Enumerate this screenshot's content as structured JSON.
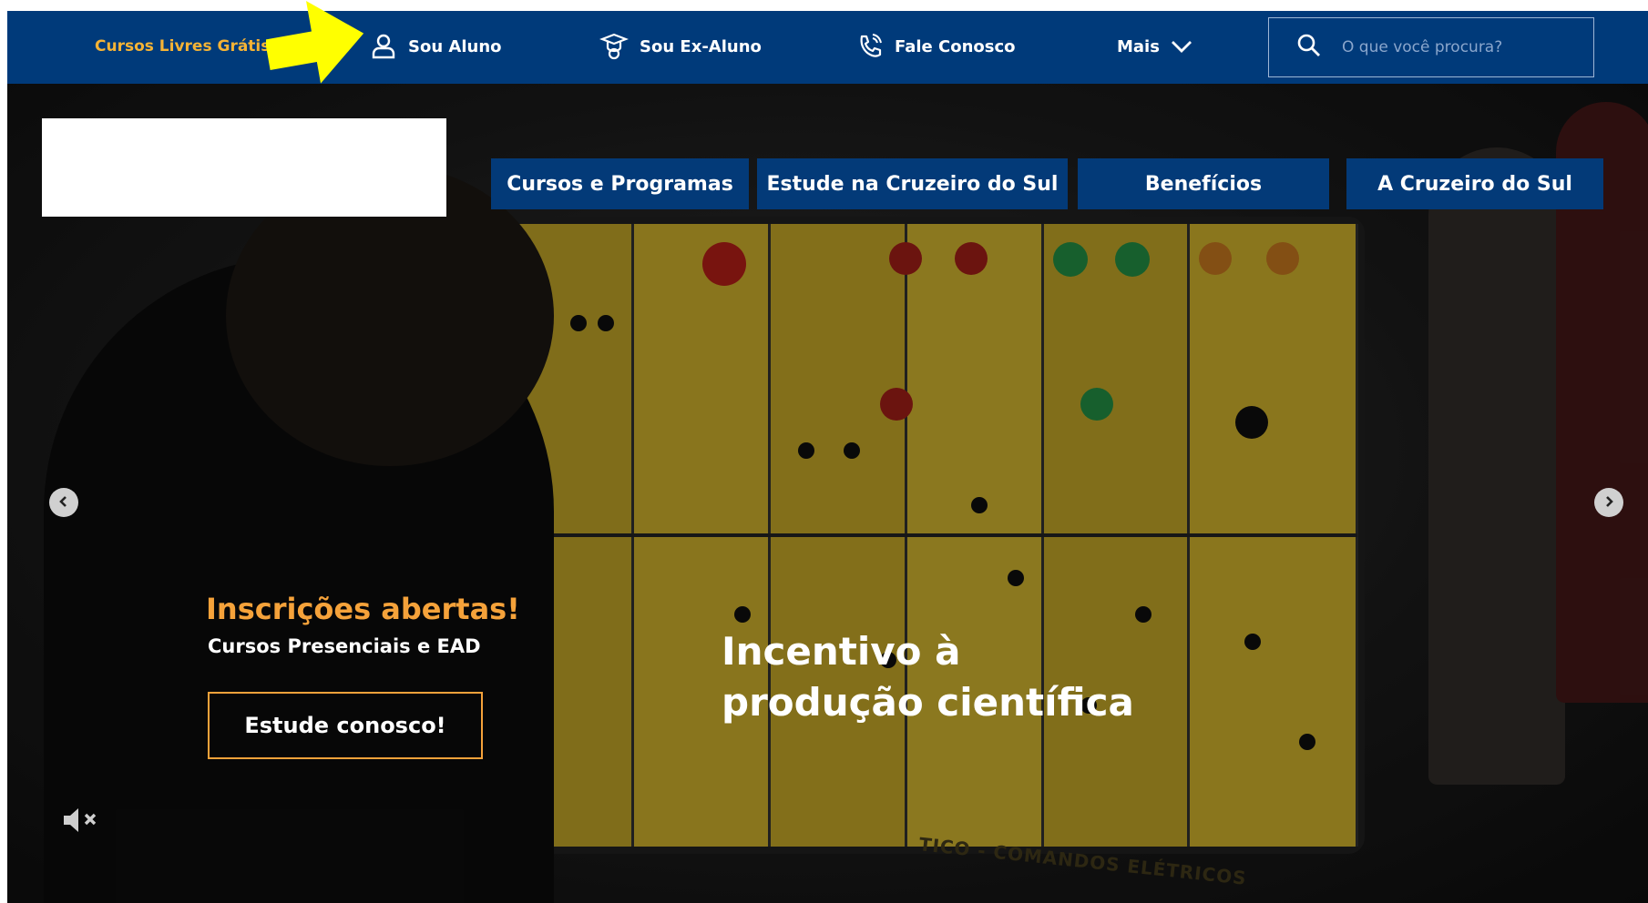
{
  "topbar": {
    "free_courses": "Cursos Livres Grátis",
    "links": [
      {
        "label": "Sou Aluno",
        "icon": "user-icon"
      },
      {
        "label": "Sou Ex-Aluno",
        "icon": "graduate-icon"
      },
      {
        "label": "Fale Conosco",
        "icon": "phone-icon"
      },
      {
        "label": "Mais",
        "icon": "chevron-down-icon"
      }
    ],
    "search_placeholder": "O que você procura?"
  },
  "nav": {
    "items": [
      "Cursos e Programas",
      "Estude na Cruzeiro do Sul",
      "Benefícios",
      "A Cruzeiro do Sul"
    ]
  },
  "hero": {
    "badge": "Inscrições abertas!",
    "subtitle": "Cursos Presenciais e EAD",
    "cta": "Estude conosco!",
    "headline_line1": "Incentivo à",
    "headline_line2": "produção científica",
    "panel_label": "TICO - COMANDOS ELÉTRICOS"
  },
  "colors": {
    "topbar_bg": "#003a7a",
    "nav_bg": "#033a78",
    "accent_orange": "#f5a23a",
    "free_courses_text": "#f5b335",
    "annotation_arrow": "#ffff00"
  }
}
